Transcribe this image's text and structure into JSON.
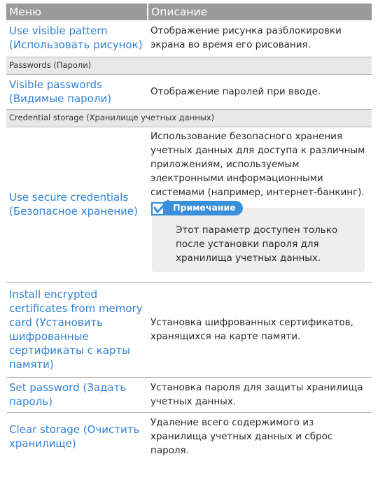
{
  "header": {
    "menu": "Меню",
    "description": "Описание"
  },
  "rows": [
    {
      "menu": "Use visible pattern (Использовать рисунок)",
      "description": "Отображение рисунка разблокировки экрана во время его рисования."
    },
    {
      "section": "Passwords (Пароли)"
    },
    {
      "menu": "Visible passwords (Видимые пароли)",
      "description": "Отображение паролей при вводе."
    },
    {
      "section": "Credential storage (Хранилище учетных данных)"
    },
    {
      "menu": "Use secure credentials (Безопасное хранение)",
      "description": "Использование безопасного хранения учетных данных для доступа к различным приложениям, используемым электронными информационными системами (например, интернет-банкинг).",
      "note": {
        "label": "Примечание",
        "text": "Этот параметр доступен только после установки пароля для хранилища учетных данных.",
        "icon": "note-check-icon"
      }
    },
    {
      "menu": "Install encrypted certificates from memory card (Установить шифрованные сертификаты с карты памяти)",
      "description": "Установка шифрованных сертификатов, хранящихся на карте памяти."
    },
    {
      "menu": "Set password (Задать пароль)",
      "description": "Установка пароля для защиты хранилища учетных данных."
    },
    {
      "menu": "Clear storage (Очистить хранилище)",
      "description": "Удаление всего содержимого из хранилища учетных данных и сброс пароля."
    }
  ],
  "colors": {
    "header_bg": "#9a9a9a",
    "menu_text": "#2f82d6",
    "section_bg": "#e8e8e8",
    "note_bg": "#eeeeee",
    "note_badge": "#3a8fd9"
  }
}
